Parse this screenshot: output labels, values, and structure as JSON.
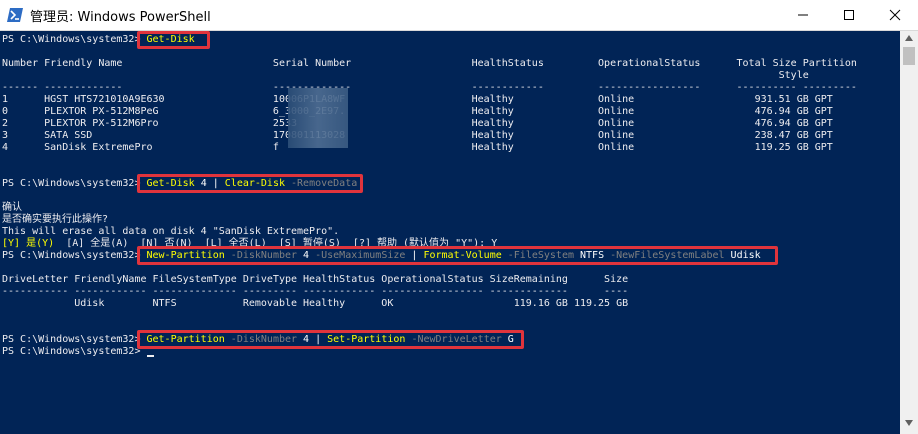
{
  "window": {
    "title": "管理员: Windows PowerShell"
  },
  "console": {
    "l1": {
      "prompt": "PS C:\\Windows\\system32> ",
      "cmd": "Get-Disk"
    },
    "l3": "Number Friendly Name                         Serial Number                    HealthStatus         OperationalStatus      Total Size Partition",
    "l4": "                                                                                                                                 Style",
    "l5": "------ -------------                         -------------                    ------------         -----------------      ---------- ---------",
    "disks": [
      "1      HGST HTS721010A9E630                  10006P1LA8WF                     Healthy              Online                    931.51 GB GPT",
      "0      PLEXTOR PX-512M8PeG                   6_3000_2E97.                     Healthy              Online                    476.94 GB GPT",
      "2      PLEXTOR PX-512M6Pro                   2533                             Healthy              Online                    476.94 GB GPT",
      "3      SATA SSD                              170801113028                     Healthy              Online                    238.47 GB GPT",
      "4      SanDisk ExtremePro                    f                                Healthy              Online                    119.25 GB GPT"
    ],
    "l2cmd": {
      "prompt": "PS C:\\Windows\\system32> ",
      "c1": "Get-Disk",
      "a1": " 4 | ",
      "c2": "Clear-Disk",
      "p1": " -RemoveData"
    },
    "confirm": "确认",
    "confirm_q": "是否确实要执行此操作?",
    "erase": "This will erase all data on disk 4 \"SanDisk ExtremePro\".",
    "choices": {
      "y": "[Y] 是(Y)",
      "rest": "  [A] 全是(A)  [N] 否(N)  [L] 全否(L)  [S] 暂停(S)  [?] 帮助 (默认值为 \"Y\"): Y"
    },
    "l3cmd": {
      "prompt": "PS C:\\Windows\\system32> ",
      "c1": "New-Partition",
      "p1": " -DiskNumber",
      "a1": " 4",
      "p2": " -UseMaximumSize",
      "a2": " | ",
      "c2": "Format-Volume",
      "p3": " -FileSystem",
      "a3": " NTFS",
      "p4": " -NewFileSystemLabel",
      "a4": " Udisk"
    },
    "vol_header": "DriveLetter FriendlyName FileSystemType DriveType HealthStatus OperationalStatus SizeRemaining      Size",
    "vol_sep": "----------- ------------ -------------- --------- ------------ ----------------- -------------      ----",
    "vol_row": "            Udisk        NTFS           Removable Healthy      OK                    119.16 GB 119.25 GB",
    "l4cmd": {
      "prompt": "PS C:\\Windows\\system32> ",
      "c1": "Get-Partition",
      "p1": " -DiskNumber",
      "a1": " 4 | ",
      "c2": "Set-Partition",
      "p2": " -NewDriveLetter",
      "a2": " G"
    },
    "l5prompt": "PS C:\\Windows\\system32> "
  },
  "colors": {
    "bg": "#012456",
    "fg": "#eeedf0",
    "cmd": "#ffff00",
    "param": "#808080",
    "highlight": "#e0343c"
  }
}
